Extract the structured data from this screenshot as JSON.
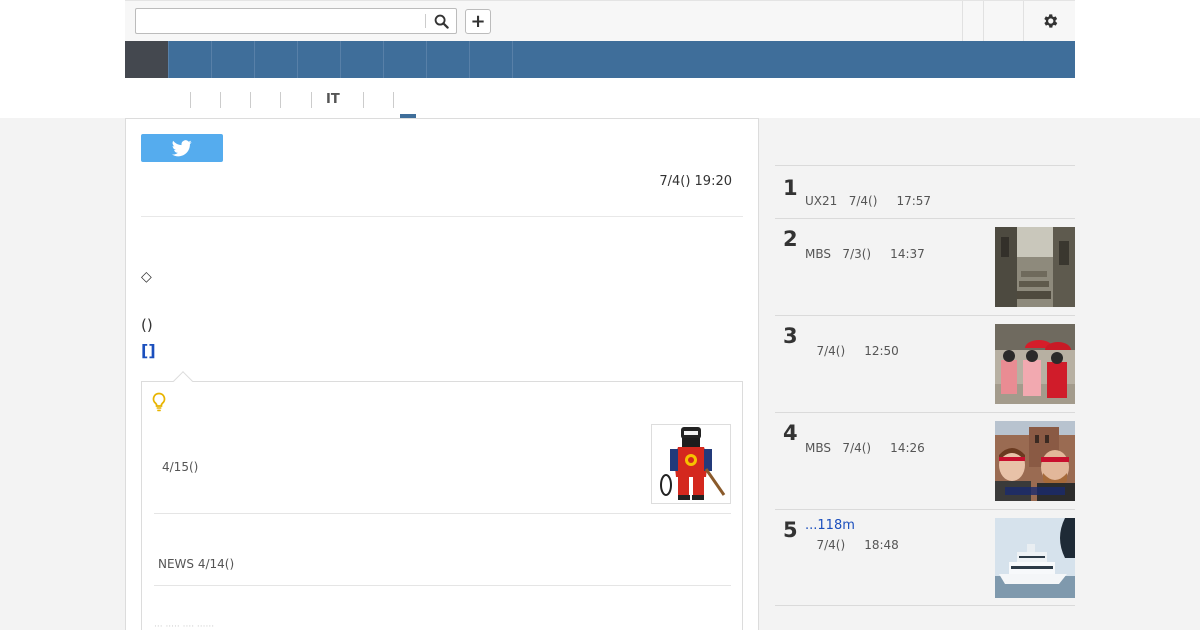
{
  "toolbar": {
    "search_value": "",
    "search_placeholder": "",
    "plus_label": "+"
  },
  "nav": {
    "items": [
      "",
      "",
      "",
      "",
      "",
      "",
      "",
      "",
      ""
    ]
  },
  "subnav": {
    "tabs": [
      "",
      "",
      "",
      "",
      "",
      "IT",
      ""
    ]
  },
  "article": {
    "timestamp": "7/4() 19:20",
    "diamond": "◇",
    "paren": "()",
    "link": "[]",
    "related": {
      "item1_date": "4/15()",
      "item2_date": "NEWS  4/14()",
      "faded": "··· ····· ···· ······"
    }
  },
  "ranking": {
    "items": [
      {
        "rank": "1",
        "meta": "UX21   7/4()     17:57",
        "title": ""
      },
      {
        "rank": "2",
        "meta": "MBS   7/3()     14:37",
        "title": ""
      },
      {
        "rank": "3",
        "meta": "   7/4()     12:50",
        "title": ""
      },
      {
        "rank": "4",
        "meta": "MBS   7/4()     14:26",
        "title": ""
      },
      {
        "rank": "5",
        "meta": "   7/4()     18:48",
        "title": "...118m"
      }
    ]
  },
  "colors": {
    "nav_blue": "#3f6e9a",
    "nav_active": "#44484f",
    "twitter": "#55acee",
    "link": "#1b4fbd"
  },
  "icons": {
    "search": "search-icon",
    "gear": "gear-icon",
    "twitter": "twitter-bird-icon",
    "bulb": "lightbulb-icon"
  }
}
